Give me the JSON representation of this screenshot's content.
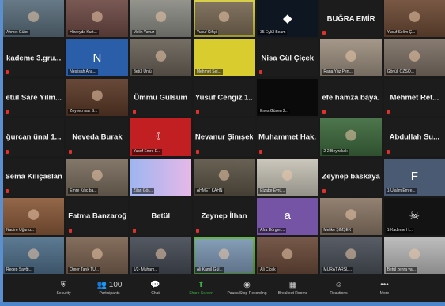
{
  "participants": [
    {
      "display": "video",
      "label": "Ahmet Güler",
      "bg": "#5a6e7c"
    },
    {
      "display": "video",
      "label": "Hüveyda Kurt...",
      "bg": "#6e4a45"
    },
    {
      "display": "video",
      "label": "Melih Yavuz",
      "bg": "#8b8b84"
    },
    {
      "display": "video",
      "label": "Yusuf Çiftçi",
      "bg": "#7a6a55",
      "highlight": "yellow"
    },
    {
      "display": "avatar",
      "label": "35 Eylül Beam",
      "avatar": "logo-icon",
      "bg": "#0e1622"
    },
    {
      "display": "name",
      "name": "BUĞRA EMİR"
    },
    {
      "display": "video",
      "label": "Yusuf Selim Ç...",
      "bg": "#6d4a35"
    },
    {
      "display": "name",
      "name": "kademe 3.gru..."
    },
    {
      "display": "avatar",
      "label": "Neslişah Ana...",
      "avatar": "N",
      "bg": "#2a5ea8"
    },
    {
      "display": "video",
      "label": "Betül Ünlü",
      "bg": "#6a6258"
    },
    {
      "display": "avatar",
      "label": "Mehmet Sel...",
      "bg": "#d9cc2f"
    },
    {
      "display": "name",
      "name": "Nisa Gül Çiçek"
    },
    {
      "display": "video",
      "label": "Rana Yüz Pen...",
      "bg": "#9d8f80"
    },
    {
      "display": "video",
      "label": "Gönüll ÖZSO...",
      "bg": "#7d7065"
    },
    {
      "display": "name",
      "name": "etül Sare Yılm..."
    },
    {
      "display": "video",
      "label": "Zeynep naz S...",
      "bg": "#5c3a28"
    },
    {
      "display": "name",
      "name": "Ümmü Gülsüm"
    },
    {
      "display": "name",
      "name": "Yusuf Cengiz 1..."
    },
    {
      "display": "avatar",
      "label": "Enes Güven 2...",
      "bg": "#0a0a0a"
    },
    {
      "display": "name",
      "name": "efe hamza baya..."
    },
    {
      "display": "name",
      "name": "Mehmet Ret..."
    },
    {
      "display": "name",
      "name": "ğurcan ünal 1..."
    },
    {
      "display": "name",
      "name": "Neveda Burak"
    },
    {
      "display": "avatar",
      "label": "Yusuf Emre E...",
      "avatar": "flag-icon",
      "bg": "#c21f22"
    },
    {
      "display": "name",
      "name": "Nevanur Şimşek"
    },
    {
      "display": "name",
      "name": "Muhammet Hak..."
    },
    {
      "display": "video",
      "label": "2-2 Beyzakalı",
      "bg": "#3e6a3e"
    },
    {
      "display": "name",
      "name": "Abdullah Su..."
    },
    {
      "display": "name",
      "name": "Sema Kılıçaslan"
    },
    {
      "display": "video",
      "label": "Emre Kılıç ba...",
      "bg": "#7a6d5e"
    },
    {
      "display": "avatar",
      "label": "Zilan Gör...",
      "avatar": "gradient",
      "bg": "#b49bd6"
    },
    {
      "display": "video",
      "label": "AHMET KAHN",
      "bg": "#5c5446"
    },
    {
      "display": "video",
      "label": "Elzabe Eyrü...",
      "bg": "#c7c3b7"
    },
    {
      "display": "name",
      "name": "Zeynep baskaya"
    },
    {
      "display": "avatar",
      "label": "1-Ülalim Emre...",
      "avatar": "F",
      "bg": "#4a5a73"
    },
    {
      "display": "video",
      "label": "Nadire Uğurlu...",
      "bg": "#8a5a3a"
    },
    {
      "display": "name",
      "name": "Fatma Banzaroğlu"
    },
    {
      "display": "name",
      "name": "Betül"
    },
    {
      "display": "name",
      "name": "Zeynep İlhan"
    },
    {
      "display": "avatar",
      "label": "Afra Dörgen...",
      "avatar": "a",
      "bg": "#7654a5"
    },
    {
      "display": "video",
      "label": "Melike ŞİMŞEK",
      "bg": "#8a7766"
    },
    {
      "display": "avatar",
      "label": "1-Kademe H...",
      "avatar": "skull-icon",
      "bg": "#131313"
    },
    {
      "display": "video",
      "label": "Recep Sayğı...",
      "bg": "#4f6f8a"
    },
    {
      "display": "video",
      "label": "Ömer Tarık TÜ...",
      "bg": "#7a6250"
    },
    {
      "display": "video",
      "label": "1/2- Muham...",
      "bg": "#454b55"
    },
    {
      "display": "video",
      "label": "Ali Kamil Gül...",
      "bg": "#7d97b4",
      "highlight": "green"
    },
    {
      "display": "video",
      "label": "Ali Çiçek",
      "bg": "#6a4a3a"
    },
    {
      "display": "video",
      "label": "MÜRAT ARSL...",
      "bg": "#4a4f58"
    },
    {
      "display": "video",
      "label": "Betül zehra ya...",
      "bg": "#b8b8b8"
    }
  ],
  "toolbar": [
    {
      "icon": "security-icon",
      "glyph": "⛨",
      "label": "Security"
    },
    {
      "icon": "participants-icon",
      "glyph": "👥 100",
      "label": "Participants"
    },
    {
      "icon": "chat-icon",
      "glyph": "💬",
      "label": "Chat"
    },
    {
      "icon": "share-screen-icon",
      "glyph": "⬆",
      "label": "Share Screen",
      "accent": true
    },
    {
      "icon": "record-icon",
      "glyph": "◉",
      "label": "Pause/Stop Recording"
    },
    {
      "icon": "breakout-rooms-icon",
      "glyph": "▦",
      "label": "Breakout Rooms"
    },
    {
      "icon": "reactions-icon",
      "glyph": "☺",
      "label": "Reactions"
    },
    {
      "icon": "more-icon",
      "glyph": "•••",
      "label": "More"
    }
  ]
}
